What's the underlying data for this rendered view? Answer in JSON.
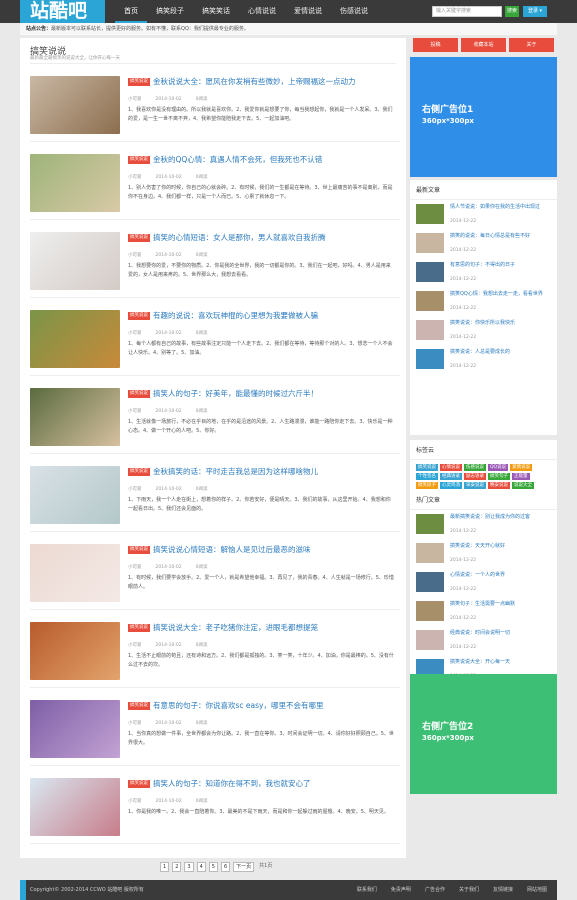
{
  "logo": "站酷吧",
  "nav": [
    "首页",
    "搞笑段子",
    "搞笑笑话",
    "心情说说",
    "爱情说说",
    "伤感说说"
  ],
  "search": {
    "placeholder": "输入关键字搜索",
    "button": "搜索",
    "login": "登录 ▾"
  },
  "notice": {
    "label": "站点公告：",
    "text": "最新版本可以联系站长，提供更好的服务。如有不懂，联系QQ：我们提供最专业的服务。"
  },
  "main": {
    "title": "搞笑说说",
    "subtitle": "最新最全最搞笑的说说大全，让你开心每一天"
  },
  "posts": [
    {
      "tag": "搞笑说说",
      "title": "金秋说说大全：愿风在你发梢有些微妙，上帝赐福这一点动力",
      "author": "小可爱",
      "date": "2014-10-02",
      "views": "0阅读",
      "text": "1、我喜欢你是没有理由的。所以我就是喜欢你。2、我爱你就是想要了你，每当我想起你，我就是一个人发呆。3、我们的爱，是一生一世不离不弃，4、我希望你能陪我走下去。5、一起加油吧。"
    },
    {
      "tag": "搞笑说说",
      "title": "金秋的QQ心情：真遇人情不会死，但我死也不认错",
      "author": "小可爱",
      "date": "2014-10-02",
      "views": "0阅读",
      "text": "1、别人伤害了你的时候，你自己的心就会碎。2、有时候，我们的一生都是在等待。3、世上最痛苦的事不是离别，而是你不在身边。4、我们都一样，只是一个人而已。5、心累了就休息一下。"
    },
    {
      "tag": "搞笑说说",
      "title": "搞笑的心情短语：女人是那你，男人就喜欢自我折腾",
      "author": "小可爱",
      "date": "2014-10-02",
      "views": "0阅读",
      "text": "1、我想要你的爱，不要你的物质。2、你是我的全世界，我的一切都是你的。3、我们在一起吧，好吗。4、男人是用来爱的，女人是用来疼的。5、世界那么大，我想去看看。"
    },
    {
      "tag": "搞笑说说",
      "title": "有趣的说说：喜欢玩神棍的心里想为我要做被人骗",
      "author": "小可爱",
      "date": "2014-10-02",
      "views": "0阅读",
      "text": "1、每个人都有自己的故事，有些故事注定只能一个人走下去。2、我们都在等待，等待那个对的人。3、想念一个人不会让人快乐。4、别等了。5、加油。"
    },
    {
      "tag": "搞笑说说",
      "title": "搞笑人的句子：好美年，能最懂的时候过六斤半！",
      "author": "小可爱",
      "date": "2014-10-02",
      "views": "0阅读",
      "text": "1、生活就像一场旅行，不必在乎目的地，在乎的是沿途的风景。2、人生路漫漫，谁能一路陪你走下去。3、快乐是一种心态。4、做一个开心的人吧。5、你好。"
    },
    {
      "tag": "搞笑说说",
      "title": "金秋搞笑的话：平时走吉我总是因为这样哪啥物儿",
      "author": "小可爱",
      "date": "2014-10-02",
      "views": "0阅读",
      "text": "1、下雨天，我一个人走在街上，想着你的样子。2、你若安好，便是晴天。3、我们的故事，从这里开始。4、我想和你一起看日出。5、我们还会见面的。"
    },
    {
      "tag": "搞笑说说",
      "title": "搞笑说说心情短语：解恼人是见过后最恶的滋味",
      "author": "小可爱",
      "date": "2014-10-02",
      "views": "0阅读",
      "text": "1、有时候，我们要学会放手。2、爱一个人，就是希望他幸福。3、再见了，我的青春。4、人生就是一场修行。5、珍惜眼前人。"
    },
    {
      "tag": "搞笑说说",
      "title": "搞笑说说大全：老子吃猪你注定，进眼毛都想提笼",
      "author": "小可爱",
      "date": "2014-10-02",
      "views": "0阅读",
      "text": "1、生活不止眼前的苟且，还有诗和远方。2、我们都是孤独的。3、笑一笑，十年少。4、加油，你是最棒的。5、没有什么过不去的坎。"
    },
    {
      "tag": "搞笑说说",
      "title": "有意思的句子：你说喜欢sc easy，哪里不会有哪里",
      "author": "小可爱",
      "date": "2014-10-02",
      "views": "0阅读",
      "text": "1、当你真的想做一件事，全世界都会为你让路。2、我一直在等你。3、时间会证明一切。4、请你好好照顾自己。5、世界很大。"
    },
    {
      "tag": "搞笑说说",
      "title": "搞笑人的句子：知道你在得不到，我也就安心了",
      "author": "小可爱",
      "date": "2014-10-02",
      "views": "0阅读",
      "text": "1、你是我的唯一。2、我会一直陪着你。3、最美的不是下雨天，而是和你一起躲过雨的屋檐。4、晚安。5、明天见。"
    }
  ],
  "pager": {
    "pages": [
      "1",
      "2",
      "3",
      "4",
      "5",
      "6"
    ],
    "next": "下一页",
    "total": "共1页"
  },
  "sidebar": {
    "buttons": [
      "投稿",
      "收藏本站",
      "关于"
    ],
    "ad1": {
      "title": "右侧广告位1",
      "size": "360px*300px"
    },
    "ad2": {
      "title": "右侧广告位2",
      "size": "360px*300px"
    },
    "latest_title": "最新文章",
    "latest": [
      {
        "title": "情人节说说：如果你在我的生活中出现过",
        "date": "2014-12-22"
      },
      {
        "title": "搞笑的说说：每日心情总是有些不好",
        "date": "2014-12-22"
      },
      {
        "title": "有意思的句子：不得出的日子",
        "date": "2014-12-22"
      },
      {
        "title": "搞笑QQ心情：我想出去走一走，看看世界",
        "date": "2014-12-22"
      },
      {
        "title": "搞笑说说：你快乐所以我快乐",
        "date": "2014-12-22"
      },
      {
        "title": "搞笑说说：人总是要成长的",
        "date": "2014-12-22"
      }
    ],
    "tags_title": "标签云",
    "tags": [
      "搞笑说说",
      "心情说说",
      "伤感说说",
      "QQ说说",
      "爱情说说",
      "个性签名",
      "经典语录",
      "励志语录",
      "搞笑句子",
      "正能量",
      "搞笑段子",
      "心灵鸡汤",
      "早安说说",
      "晚安说说",
      "说说大全",
      "搞笑图片",
      "搞笑短信",
      "笑话大全"
    ],
    "hot_title": "热门文章",
    "hot": [
      {
        "title": "最新搞笑说说：别让我成为你的过客",
        "date": "2014-12-22"
      },
      {
        "title": "搞笑说说：天天开心就好",
        "date": "2014-12-22"
      },
      {
        "title": "心情说说：一个人的世界",
        "date": "2014-12-22"
      },
      {
        "title": "搞笑句子：生活需要一点幽默",
        "date": "2014-12-22"
      },
      {
        "title": "经典说说：时间会说明一切",
        "date": "2014-12-22"
      },
      {
        "title": "搞笑说说大全：开心每一天",
        "date": "2014-12-22"
      }
    ]
  },
  "footer": {
    "copy": "Copyright© 2002-2014 CCWO 站酷吧 版权所有",
    "links": [
      "联系我们",
      "免责声明",
      "广告合作",
      "关于我们",
      "友情链接",
      "网站地图"
    ]
  }
}
